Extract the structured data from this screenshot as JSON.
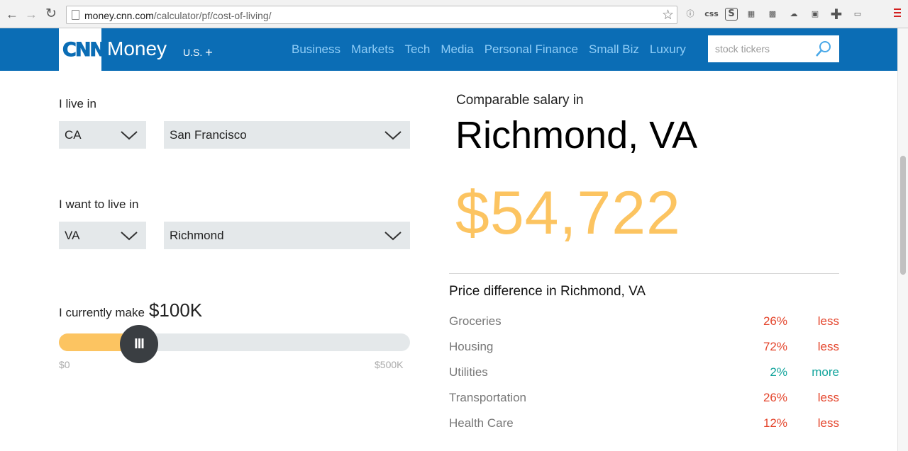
{
  "browser": {
    "url_host": "money.cnn.com",
    "url_path": "/calculator/pf/cost-of-living/",
    "extensions": [
      "info-icon",
      "css-icon",
      "s-box-icon",
      "folders-icon",
      "dsc-icon",
      "cloud-icon",
      "camera-icon",
      "crosshair-icon",
      "cast-icon"
    ]
  },
  "site": {
    "logo_text": "CNN",
    "brand": "Money",
    "edition": "U.S.",
    "edition_plus": "+",
    "nav": [
      "Business",
      "Markets",
      "Tech",
      "Media",
      "Personal Finance",
      "Small Biz",
      "Luxury"
    ],
    "search_placeholder": "stock tickers"
  },
  "calculator": {
    "live_in_label": "I live in",
    "from_state": "CA",
    "from_city": "San Francisco",
    "want_label": "I want to live in",
    "to_state": "VA",
    "to_city": "Richmond",
    "make_label": "I currently make",
    "make_amount": "$100K",
    "slider": {
      "value_fraction": 0.2,
      "thumb_label": "III",
      "min_label": "$0",
      "max_label": "$500K"
    }
  },
  "result": {
    "comparable_label": "Comparable salary in",
    "city": "Richmond, VA",
    "salary": "$54,722",
    "diff_title": "Price difference in Richmond, VA",
    "rows": [
      {
        "category": "Groceries",
        "pct": "26%",
        "dir": "less"
      },
      {
        "category": "Housing",
        "pct": "72%",
        "dir": "less"
      },
      {
        "category": "Utilities",
        "pct": "2%",
        "dir": "more"
      },
      {
        "category": "Transportation",
        "pct": "26%",
        "dir": "less"
      },
      {
        "category": "Health Care",
        "pct": "12%",
        "dir": "less"
      }
    ]
  },
  "colors": {
    "brand_blue": "#0b6db5",
    "accent_yellow": "#fcc461",
    "less_red": "#e4452c",
    "more_teal": "#10a39b"
  }
}
